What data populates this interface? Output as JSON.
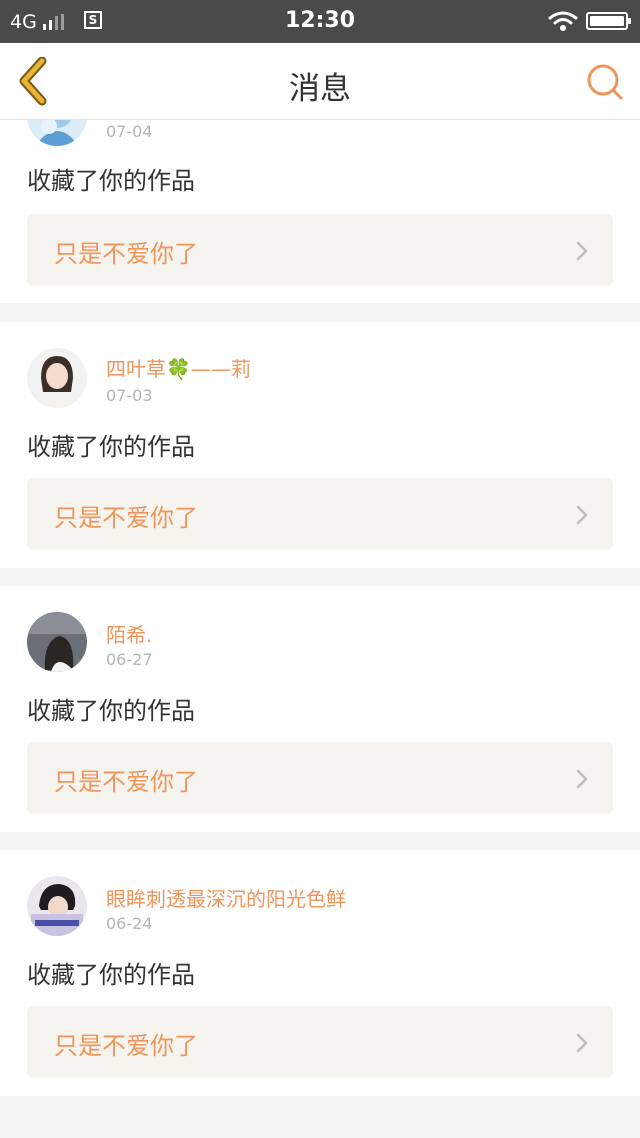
{
  "status_bar": {
    "network": "4G",
    "sim_icon": "S",
    "time": "12:30"
  },
  "header": {
    "title": "消息",
    "back_icon": "chevron-left-icon",
    "search_icon": "search-icon"
  },
  "colors": {
    "accent": "#f0955a",
    "back_chevron": "#e7b437",
    "status_bar": "#4a4a4a",
    "card_background": "#ffffff",
    "feed_background": "#f5f5f5",
    "work_box": "#f5f4ef"
  },
  "notifications": [
    {
      "username": "",
      "date": "07-04",
      "action": "收藏了你的作品",
      "work_title": "只是不爱你了"
    },
    {
      "username": "四叶草🍀——莉",
      "date": "07-03",
      "action": "收藏了你的作品",
      "work_title": "只是不爱你了"
    },
    {
      "username": "陌希.",
      "date": "06-27",
      "action": "收藏了你的作品",
      "work_title": "只是不爱你了"
    },
    {
      "username": "眼眸刺透最深沉的阳光色鲜",
      "date": "06-24",
      "action": "收藏了你的作品",
      "work_title": "只是不爱你了"
    }
  ]
}
